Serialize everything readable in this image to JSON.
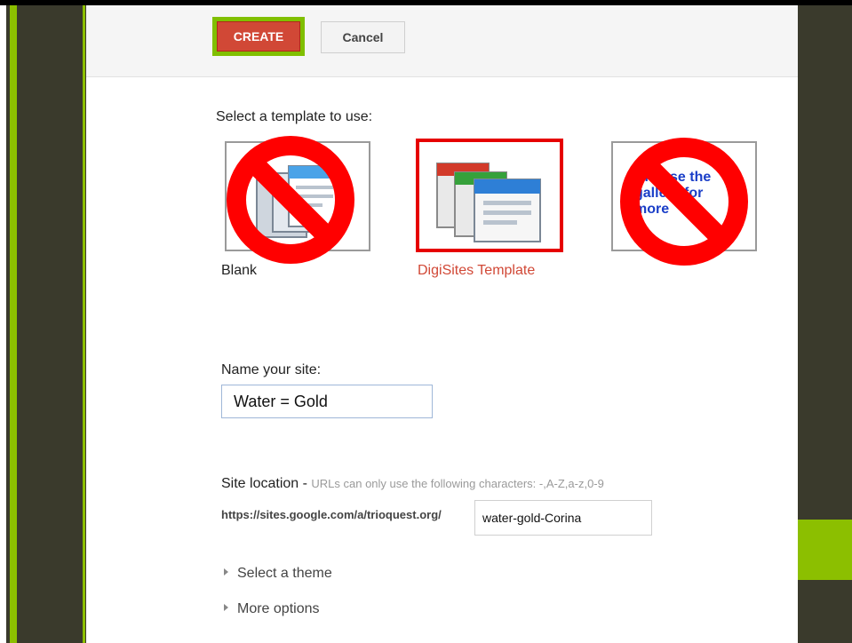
{
  "toolbar": {
    "create_label": "CREATE",
    "cancel_label": "Cancel"
  },
  "templates": {
    "heading": "Select a template to use:",
    "items": [
      {
        "caption": "Blank",
        "selected": false,
        "disabled": true
      },
      {
        "caption": "DigiSites Template",
        "selected": true,
        "disabled": false
      },
      {
        "caption": "Browse the gallery for more",
        "selected": false,
        "disabled": true
      }
    ]
  },
  "site_name": {
    "label": "Name your site:",
    "value": "Water = Gold"
  },
  "site_location": {
    "label": "Site location -",
    "hint": "URLs can only use the following characters: -,A-Z,a-z,0-9",
    "url_prefix": "https://sites.google.com/a/trioquest.org/",
    "value": "water-gold-Corina"
  },
  "expanders": [
    "Select a theme",
    "More options"
  ],
  "colors": {
    "create_button": "#d14836",
    "selection_border": "#e60000",
    "prohibit_sign": "#ff0000",
    "frame_dark": "#3a3a2c",
    "frame_green": "#8cbf00"
  },
  "icons": {
    "template_icon": "stacked-pages-icon",
    "disabled_overlay": "prohibition-sign-icon",
    "expand": "triangle-right-icon"
  }
}
